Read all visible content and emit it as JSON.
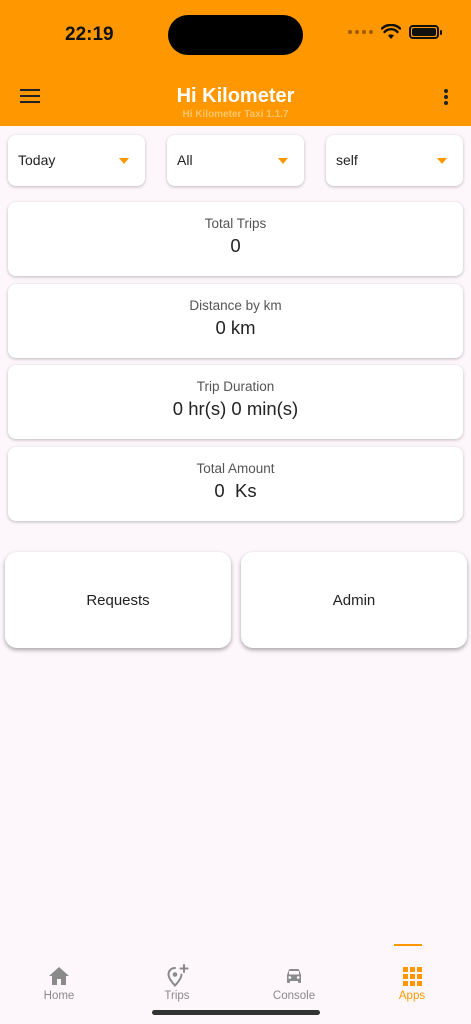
{
  "status_bar": {
    "time": "22:19"
  },
  "app_bar": {
    "title": "Hi Kilometer",
    "subtitle": "Hi Kilometer Taxi 1.1.7"
  },
  "filters": [
    {
      "label": "Today"
    },
    {
      "label": "All"
    },
    {
      "label": "self"
    }
  ],
  "stats": [
    {
      "label": "Total Trips",
      "value": "0"
    },
    {
      "label": "Distance by km",
      "value": "0 km"
    },
    {
      "label": "Trip Duration",
      "value": "0 hr(s) 0 min(s)"
    },
    {
      "label": "Total Amount",
      "value": "0  Ks"
    }
  ],
  "apps": [
    {
      "label": "Requests"
    },
    {
      "label": "Admin"
    }
  ],
  "bottom_nav": {
    "items": [
      {
        "label": "Home",
        "icon": "home-icon"
      },
      {
        "label": "Trips",
        "icon": "location-plus-icon"
      },
      {
        "label": "Console",
        "icon": "car-icon"
      },
      {
        "label": "Apps",
        "icon": "grid-icon"
      }
    ],
    "active": "Apps"
  },
  "colors": {
    "accent": "#ff9800",
    "background": "#fdf7fb",
    "inactive": "#8a8a8a"
  }
}
